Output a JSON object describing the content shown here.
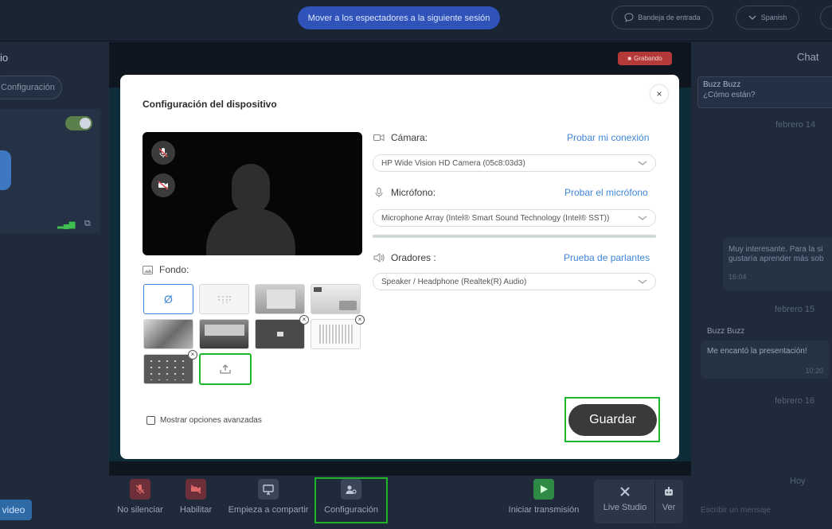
{
  "topbar": {
    "move_label": "Mover a los espectadores a la siguiente sesión",
    "inbox_label": "Bandeja de entrada",
    "language_label": "Spanish"
  },
  "left_panel": {
    "title_fragment": "io",
    "config_label": "Configuración",
    "video_label": "video"
  },
  "stage": {
    "recording_label": "Grabando"
  },
  "toolbar": {
    "unmute_label": "No silenciar",
    "enable_label": "Habilitar",
    "share_label": "Empieza a compartir",
    "config_label": "Configuración",
    "start_stream_label": "Iniciar transmisión",
    "live_studio_label": "Live Studio",
    "view_label": "Ver"
  },
  "chat": {
    "title": "Chat",
    "messages": [
      {
        "author": "Buzz Buzz",
        "text": "¿Cómo están?"
      },
      {
        "text_line1": "Muy interesante. Para la si",
        "text_line2": "gustaría aprender más sob",
        "time": "16:04"
      },
      {
        "author": "Buzz Buzz",
        "text": "Me encantó la presentación!",
        "time": "10:20"
      }
    ],
    "dates": [
      "febrero 14",
      "febrero 15",
      "febrero 16",
      "Hoy"
    ],
    "input_placeholder": "Escribir un mensaje"
  },
  "modal": {
    "title": "Configuración del dispositivo",
    "close_glyph": "×",
    "camera_label": "Cámara:",
    "camera_link": "Probar mi conexión",
    "camera_value": "HP Wide Vision HD Camera (05c8:03d3)",
    "mic_label": "Micrófono:",
    "mic_link": "Probar el micrófono",
    "mic_value": "Microphone Array (Intel® Smart Sound Technology (Intel® SST))",
    "speakers_label": "Oradores :",
    "speakers_link": "Prueba de parlantes",
    "speakers_value": "Speaker / Headphone (Realtek(R) Audio)",
    "background_label": "Fondo:",
    "advanced_label": "Mostrar opciones avanzadas",
    "save_label": "Guardar",
    "none_glyph": "Ø"
  },
  "colors": {
    "accent_blue": "#3f86d8",
    "highlight_green": "#1db52a",
    "recording_red": "#b43a3a"
  }
}
